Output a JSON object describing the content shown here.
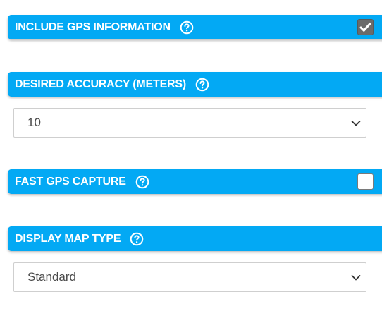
{
  "sections": {
    "include_gps": {
      "label": "INCLUDE GPS INFORMATION",
      "help_icon": "question-circle-icon",
      "checked": true
    },
    "desired_accuracy": {
      "label": "DESIRED ACCURACY (METERS)",
      "help_icon": "question-circle-icon",
      "select_value": "10"
    },
    "fast_gps": {
      "label": "FAST GPS CAPTURE",
      "help_icon": "question-circle-icon",
      "checked": false
    },
    "map_type": {
      "label": "DISPLAY MAP TYPE",
      "help_icon": "question-circle-icon",
      "select_value": "Standard"
    }
  },
  "colors": {
    "header_bar": "#03a9f4",
    "header_text": "#ffffff",
    "checkbox_checked": "#6b6b6b",
    "select_border": "#cfcfcf",
    "select_text": "#4a4a4a"
  }
}
